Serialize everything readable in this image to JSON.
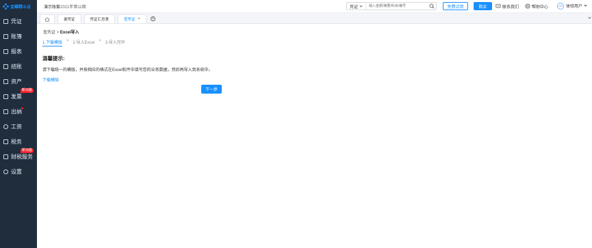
{
  "brand": {
    "name": "金蝶精斗云",
    "colors": {
      "primary": "#1890ff",
      "sidebar": "#1f2d3d",
      "badge": "#f5222d"
    }
  },
  "sidebar": {
    "items": [
      {
        "label": "凭证",
        "icon": "voucher-icon"
      },
      {
        "label": "账簿",
        "icon": "ledger-icon"
      },
      {
        "label": "报表",
        "icon": "report-icon"
      },
      {
        "label": "结账",
        "icon": "close-account-icon"
      },
      {
        "label": "资产",
        "icon": "asset-icon"
      },
      {
        "label": "发票",
        "icon": "invoice-icon",
        "badge": "新功能"
      },
      {
        "label": "出纳",
        "icon": "cashier-icon",
        "dot": true
      },
      {
        "label": "工资",
        "icon": "salary-icon"
      },
      {
        "label": "税务",
        "icon": "tax-icon"
      },
      {
        "label": "财税服务",
        "icon": "finance-service-icon",
        "badge": "新功能"
      },
      {
        "label": "设置",
        "icon": "settings-icon"
      }
    ]
  },
  "header": {
    "account_name": "演示账套",
    "period": "2021年第11期",
    "search": {
      "category": "凭证",
      "placeholder": "输入金额/摘要/科目/编号"
    },
    "trial_button": "免费试用",
    "buy_button": "购买",
    "contact_label": "联系我们",
    "help_label": "帮助中心",
    "user_label": "体验用户"
  },
  "tabs": [
    {
      "label": "",
      "icon": "home-icon"
    },
    {
      "label": "录凭证"
    },
    {
      "label": "凭证汇总表"
    },
    {
      "label": "查凭证",
      "active": true,
      "closable": true
    }
  ],
  "main": {
    "breadcrumb": {
      "parent": "查凭证",
      "separator": ">",
      "current": "Excel导入"
    },
    "steps": [
      {
        "label": "1.下载模版",
        "active": true
      },
      {
        "label": "2.导入Excel"
      },
      {
        "label": "3.导入完毕"
      }
    ],
    "step_separator": ">",
    "tips_title": "温馨提示:",
    "tips_body": "请下载统一的模版，并按相应的格式在Excel软件中填写您的业务数据，然后再导入到系统中。",
    "download_link": "下载模版",
    "next_button": "下一步"
  }
}
